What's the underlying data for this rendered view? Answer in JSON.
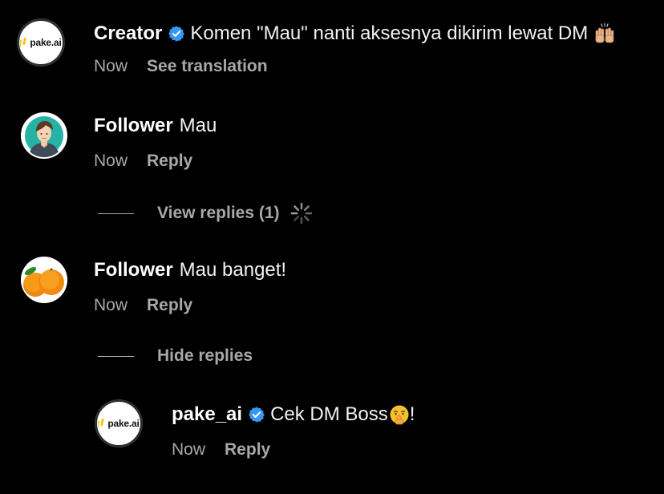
{
  "comments": [
    {
      "username": "Creator",
      "verified": true,
      "text": "Komen \"Mau\" nanti aksesnya dikirim lewat DM",
      "emoji": "raising-hands",
      "time": "Now",
      "action": "See translation",
      "avatar": "pake.ai"
    },
    {
      "username": "Follower",
      "verified": false,
      "text": "Mau",
      "time": "Now",
      "action": "Reply",
      "replies_toggle": "View replies (1)"
    },
    {
      "username": "Follower",
      "verified": false,
      "text": "Mau banget!",
      "time": "Now",
      "action": "Reply",
      "replies_toggle": "Hide replies",
      "replies": [
        {
          "username": "pake_ai",
          "verified": true,
          "text": "Cek DM Boss",
          "emoji": "shushing-face",
          "trailing": "!",
          "time": "Now",
          "action": "Reply",
          "avatar": "pake.ai"
        }
      ]
    }
  ],
  "colors": {
    "background": "#000000",
    "text": "#f5f5f5",
    "muted": "#a8a8a8",
    "verified_blue": "#3897f0",
    "logo_yellow": "#f5c518"
  }
}
